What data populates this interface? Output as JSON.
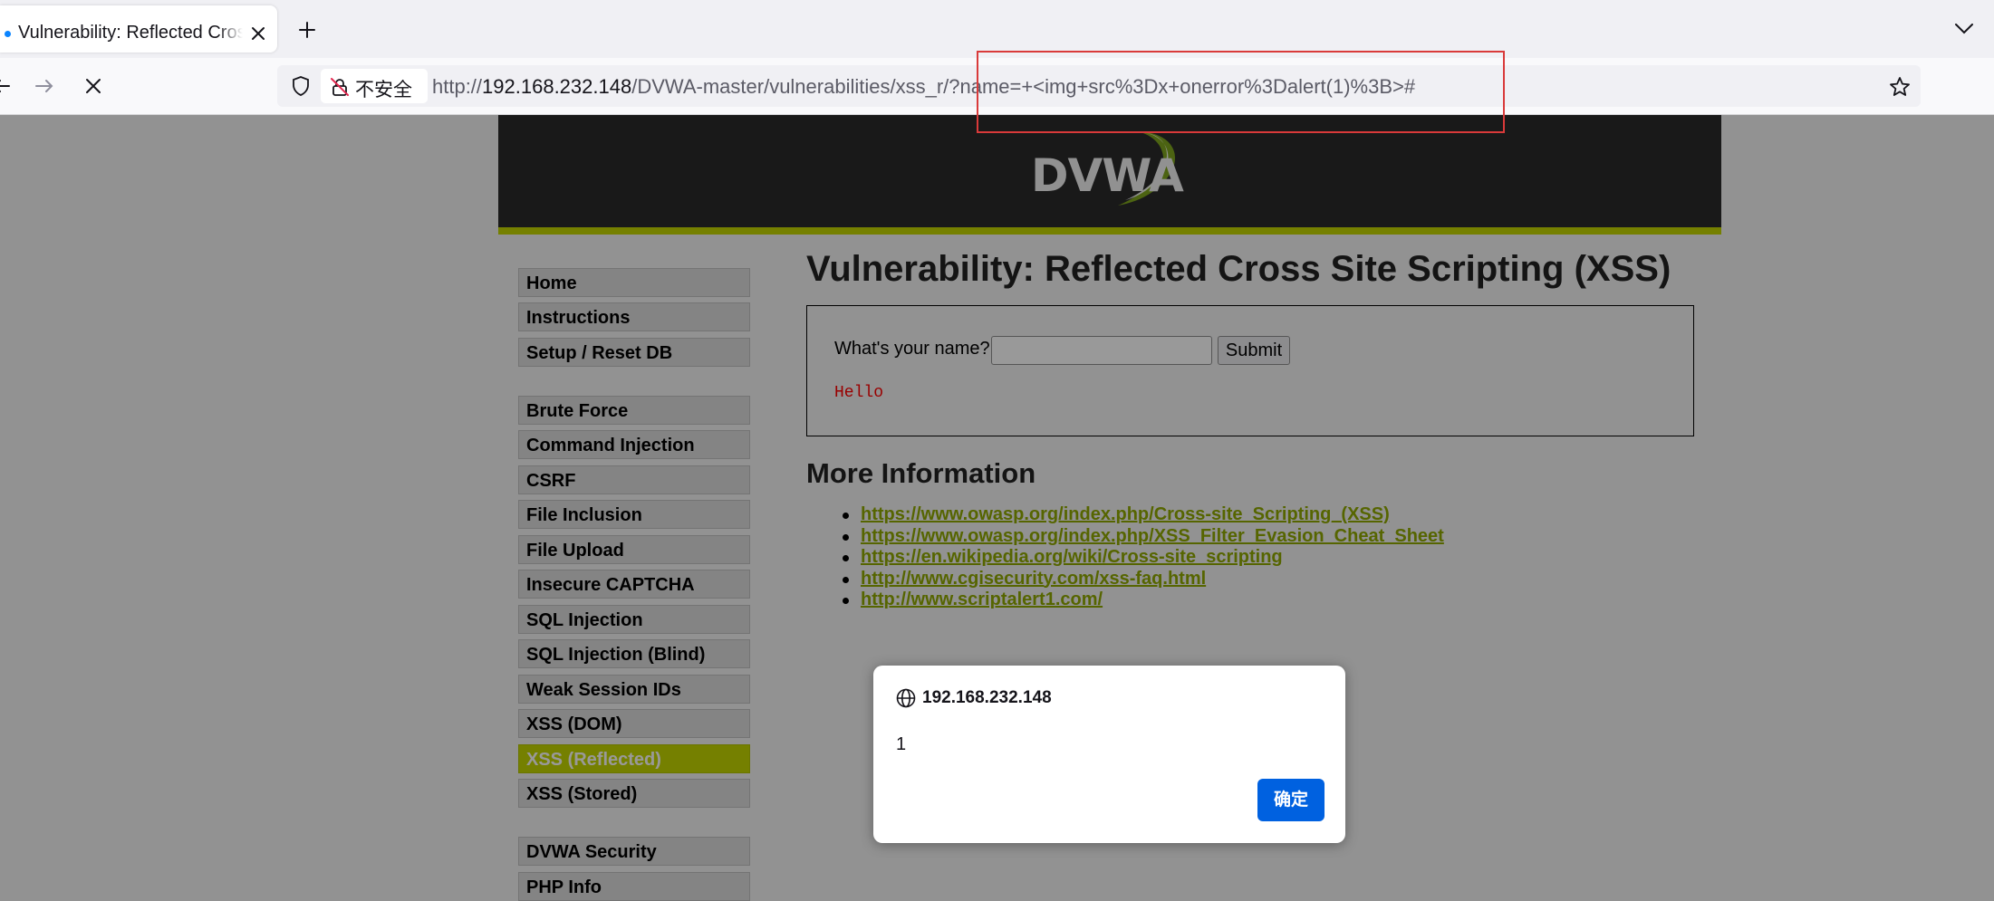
{
  "browser": {
    "tab_title": "Vulnerability: Reflected Cross Site Scripting (XSS) :: Damn Vulnerable Web Application (DVWA)",
    "insecure_label": "不安全",
    "url_prefix": "http://",
    "url_host": "192.168.232.148",
    "url_path": "/DVWA-master/vulnerabilities/xss_r/?name=+<img+src%3Dx+onerror%3Dalert(1)%3B>#",
    "accent_color": "#0a84ff"
  },
  "logo": {
    "text": "DVWA"
  },
  "menu": {
    "group1": [
      "Home",
      "Instructions",
      "Setup / Reset DB"
    ],
    "group2": [
      "Brute Force",
      "Command Injection",
      "CSRF",
      "File Inclusion",
      "File Upload",
      "Insecure CAPTCHA",
      "SQL Injection",
      "SQL Injection (Blind)",
      "Weak Session IDs",
      "XSS (DOM)",
      "XSS (Reflected)",
      "XSS (Stored)"
    ],
    "group3": [
      "DVWA Security",
      "PHP Info"
    ],
    "selected": "XSS (Reflected)"
  },
  "main": {
    "title": "Vulnerability: Reflected Cross Site Scripting (XSS)",
    "form": {
      "label": "What's your name?",
      "input_value": "",
      "submit_label": "Submit",
      "output": "Hello"
    },
    "more_info_heading": "More Information",
    "links": [
      "https://www.owasp.org/index.php/Cross-site_Scripting_(XSS)",
      "https://www.owasp.org/index.php/XSS_Filter_Evasion_Cheat_Sheet",
      "https://en.wikipedia.org/wiki/Cross-site_scripting",
      "http://www.cgisecurity.com/xss-faq.html",
      "http://www.scriptalert1.com/"
    ]
  },
  "alert": {
    "origin": "192.168.232.148",
    "message": "1",
    "ok_label": "确定"
  },
  "colors": {
    "dvwa_green": "#c4d600",
    "link_green": "#8fa800",
    "hello_red": "#ff0000",
    "alert_button": "#0061e0",
    "annotation_red": "#d93a3a"
  }
}
